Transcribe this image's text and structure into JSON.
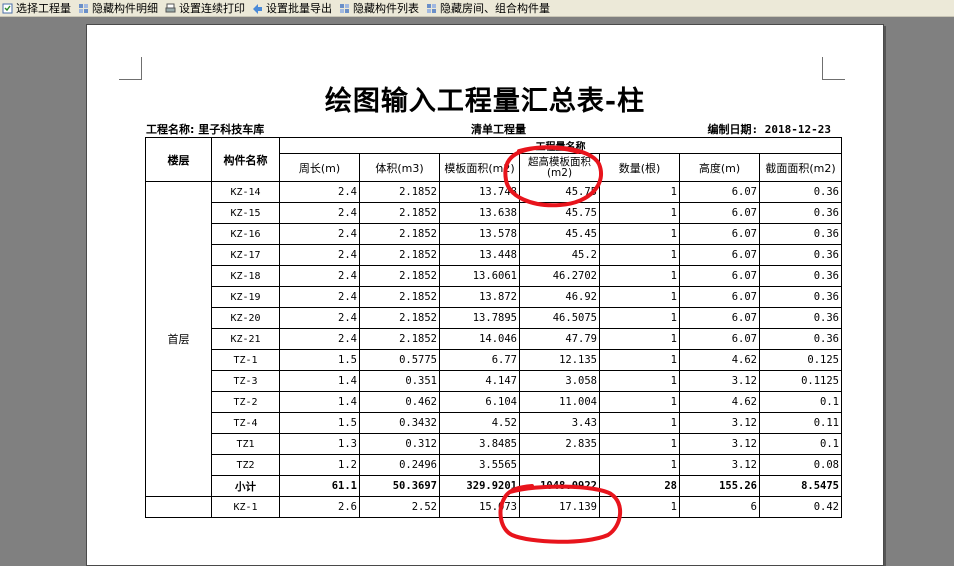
{
  "toolbar": {
    "items": [
      {
        "label": "选择工程量",
        "icon": "select-icon"
      },
      {
        "label": "隐藏构件明细",
        "icon": "hide-detail-icon"
      },
      {
        "label": "设置连续打印",
        "icon": "print-settings-icon"
      },
      {
        "label": "设置批量导出",
        "icon": "batch-export-icon"
      },
      {
        "label": "隐藏构件列表",
        "icon": "hide-list-icon"
      },
      {
        "label": "隐藏房间、组合构件量",
        "icon": "hide-room-icon"
      }
    ]
  },
  "report": {
    "title": "绘图输入工程量汇总表-柱",
    "project": "工程名称: 里子科技车库",
    "type": "清单工程量",
    "date": "编制日期: 2018-12-23",
    "headers": {
      "floor": "楼层",
      "component": "构件名称",
      "group": "工程量名称",
      "columns": [
        "周长(m)",
        "体积(m3)",
        "模板面积(m2)",
        "超高模板面积(m2)",
        "数量(根)",
        "高度(m)",
        "截面面积(m2)"
      ]
    },
    "floor_name": "首层",
    "rows": [
      {
        "name": "KZ-14",
        "values": [
          "2.4",
          "2.1852",
          "13.748",
          "45.75",
          "1",
          "6.07",
          "0.36"
        ]
      },
      {
        "name": "KZ-15",
        "values": [
          "2.4",
          "2.1852",
          "13.638",
          "45.75",
          "1",
          "6.07",
          "0.36"
        ]
      },
      {
        "name": "KZ-16",
        "values": [
          "2.4",
          "2.1852",
          "13.578",
          "45.45",
          "1",
          "6.07",
          "0.36"
        ]
      },
      {
        "name": "KZ-17",
        "values": [
          "2.4",
          "2.1852",
          "13.448",
          "45.2",
          "1",
          "6.07",
          "0.36"
        ]
      },
      {
        "name": "KZ-18",
        "values": [
          "2.4",
          "2.1852",
          "13.6061",
          "46.2702",
          "1",
          "6.07",
          "0.36"
        ]
      },
      {
        "name": "KZ-19",
        "values": [
          "2.4",
          "2.1852",
          "13.872",
          "46.92",
          "1",
          "6.07",
          "0.36"
        ]
      },
      {
        "name": "KZ-20",
        "values": [
          "2.4",
          "2.1852",
          "13.7895",
          "46.5075",
          "1",
          "6.07",
          "0.36"
        ]
      },
      {
        "name": "KZ-21",
        "values": [
          "2.4",
          "2.1852",
          "14.046",
          "47.79",
          "1",
          "6.07",
          "0.36"
        ]
      },
      {
        "name": "TZ-1",
        "values": [
          "1.5",
          "0.5775",
          "6.77",
          "12.135",
          "1",
          "4.62",
          "0.125"
        ]
      },
      {
        "name": "TZ-3",
        "values": [
          "1.4",
          "0.351",
          "4.147",
          "3.058",
          "1",
          "3.12",
          "0.1125"
        ]
      },
      {
        "name": "TZ-2",
        "values": [
          "1.4",
          "0.462",
          "6.104",
          "11.004",
          "1",
          "4.62",
          "0.1"
        ]
      },
      {
        "name": "TZ-4",
        "values": [
          "1.5",
          "0.3432",
          "4.52",
          "3.43",
          "1",
          "3.12",
          "0.11"
        ]
      },
      {
        "name": "TZ1",
        "values": [
          "1.3",
          "0.312",
          "3.8485",
          "2.835",
          "1",
          "3.12",
          "0.1"
        ]
      },
      {
        "name": "TZ2",
        "values": [
          "1.2",
          "0.2496",
          "3.5565",
          "",
          "1",
          "3.12",
          "0.08"
        ]
      }
    ],
    "subtotal": {
      "label": "小计",
      "values": [
        "61.1",
        "50.3697",
        "329.9201",
        "1048.0922",
        "28",
        "155.26",
        "8.5475"
      ]
    },
    "next_rows": [
      {
        "name": "KZ-1",
        "values": [
          "2.6",
          "2.52",
          "15.073",
          "17.139",
          "1",
          "6",
          "0.42"
        ]
      }
    ]
  },
  "colors": {
    "annotation": "#e8141c",
    "background": "#808080",
    "toolbar": "#ece9d8"
  }
}
